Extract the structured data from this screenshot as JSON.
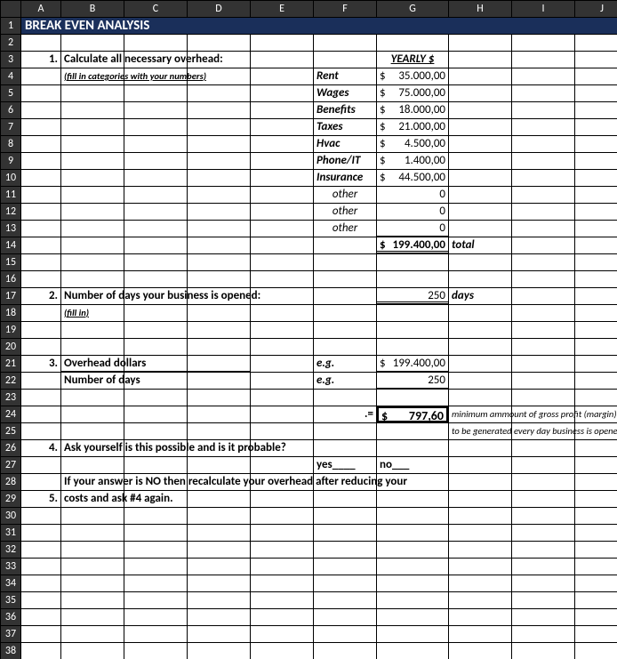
{
  "cols": [
    "",
    "A",
    "B",
    "C",
    "D",
    "E",
    "F",
    "G",
    "H",
    "I",
    "J"
  ],
  "title": "BREAK EVEN ANALYSIS",
  "s1": {
    "num": "1.",
    "heading": "Calculate all necessary overhead:",
    "sub": "(fill in categories with your numbers)",
    "yearly": "YEARLY  $",
    "items": [
      {
        "label": "Rent",
        "cur": "$",
        "val": "35.000,00"
      },
      {
        "label": "Wages",
        "cur": "$",
        "val": "75.000,00"
      },
      {
        "label": "Benefits",
        "cur": "$",
        "val": "18.000,00"
      },
      {
        "label": "Taxes",
        "cur": "$",
        "val": "21.000,00"
      },
      {
        "label": "Hvac",
        "cur": "$",
        "val": "4.500,00"
      },
      {
        "label": "Phone/IT",
        "cur": "$",
        "val": "1.400,00"
      },
      {
        "label": "Insurance",
        "cur": "$",
        "val": "44.500,00"
      },
      {
        "label": "other",
        "cur": "",
        "val": "0"
      },
      {
        "label": "other",
        "cur": "",
        "val": "0"
      },
      {
        "label": "other",
        "cur": "",
        "val": "0"
      }
    ],
    "total_cur": "$",
    "total_val": "199.400,00",
    "total_lbl": "total"
  },
  "s2": {
    "num": "2.",
    "heading": "Number of days your business is opened:",
    "sub": "(fill in)",
    "val": "250",
    "unit": "days"
  },
  "s3": {
    "num": "3.",
    "l1": "Overhead dollars",
    "l2": "Number of days",
    "eg": "e.g.",
    "v1cur": "$",
    "v1": "199.400,00",
    "v2": "250",
    "eq": ".=",
    "rescur": "$",
    "res": "797,60",
    "note1": "minimum ammount of gross profit (margin)",
    "note2": "to be generated every day business is opened"
  },
  "s4": {
    "num": "4.",
    "q": "Ask yourself is this possible and is it probable?",
    "yes": "yes____",
    "no": "no___"
  },
  "s5": {
    "num": "5.",
    "line1": "If your answer is NO then recalculate your overhead after reducing your",
    "line2": "costs and ask #4 again."
  }
}
